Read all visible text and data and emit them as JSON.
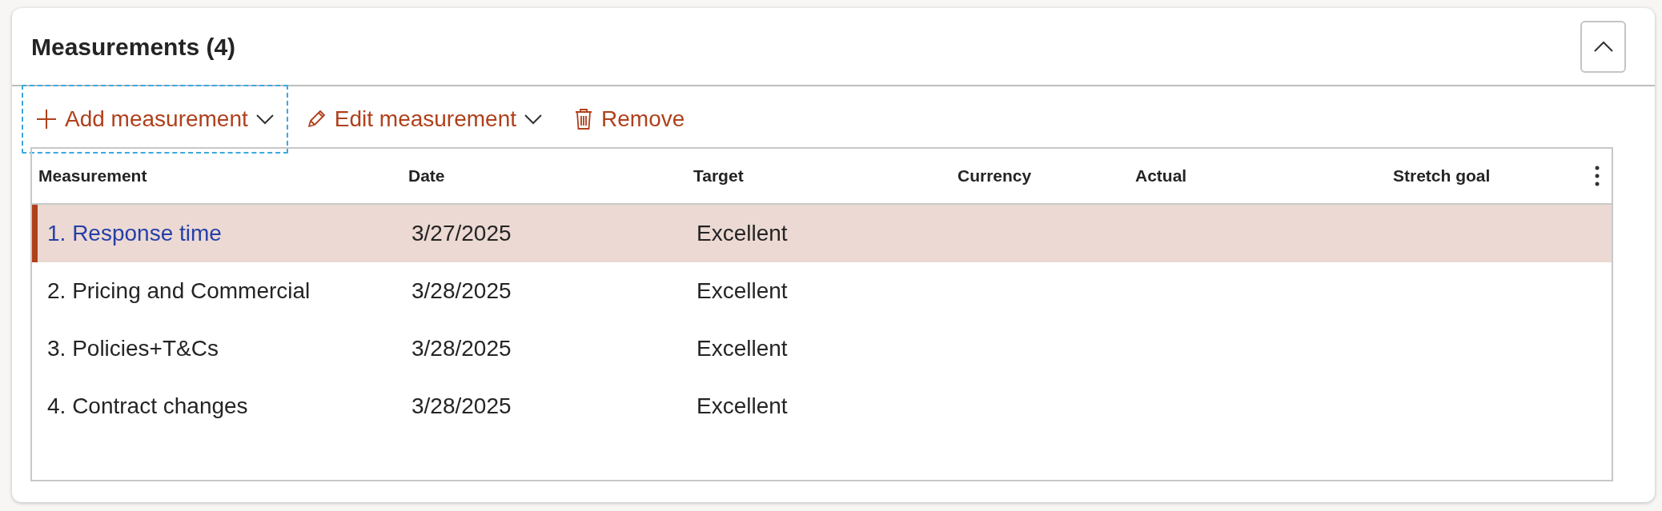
{
  "section": {
    "title": "Measurements (4)",
    "collapse_button": {
      "expanded": true
    }
  },
  "toolbar": [
    {
      "kind": "add",
      "label": "Add measurement",
      "dropdown": true,
      "focused": true
    },
    {
      "kind": "edit",
      "label": "Edit measurement",
      "dropdown": true,
      "focused": false
    },
    {
      "kind": "remove",
      "label": "Remove",
      "dropdown": false,
      "focused": false
    }
  ],
  "table": {
    "columns": [
      "Measurement",
      "Date",
      "Target",
      "Currency",
      "Actual",
      "Stretch goal"
    ],
    "rows": [
      {
        "cells": [
          "1. Response time",
          "3/27/2025",
          "Excellent",
          "",
          "",
          ""
        ],
        "selected": true
      },
      {
        "cells": [
          "2. Pricing and Commercial",
          "3/28/2025",
          "Excellent",
          "",
          "",
          ""
        ],
        "selected": false
      },
      {
        "cells": [
          "3. Policies+T&Cs",
          "3/28/2025",
          "Excellent",
          "",
          "",
          ""
        ],
        "selected": false
      },
      {
        "cells": [
          "4. Contract changes",
          "3/28/2025",
          "Excellent",
          "",
          "",
          ""
        ],
        "selected": false
      }
    ]
  }
}
